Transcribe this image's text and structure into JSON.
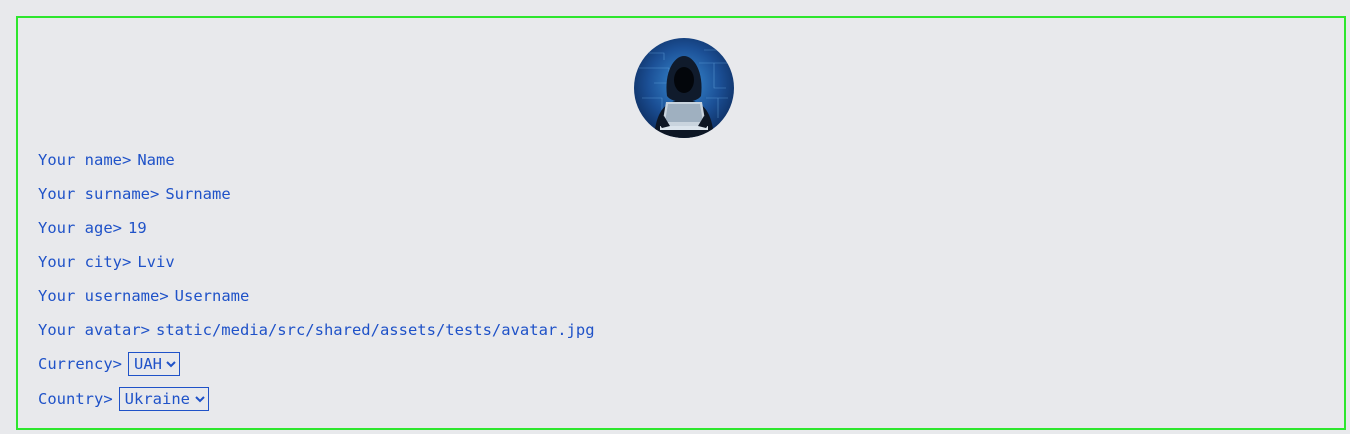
{
  "profile": {
    "name_label": "Your name>",
    "name_value": "Name",
    "surname_label": "Your surname>",
    "surname_value": "Surname",
    "age_label": "Your age>",
    "age_value": "19",
    "city_label": "Your city>",
    "city_value": "Lviv",
    "username_label": "Your username>",
    "username_value": "Username",
    "avatar_label": "Your avatar>",
    "avatar_value": "static/media/src/shared/assets/tests/avatar.jpg",
    "currency_label": "Currency>",
    "currency_selected": "UAH",
    "country_label": "Country>",
    "country_selected": "Ukraine"
  },
  "colors": {
    "text": "#1f52c8",
    "border": "#2ee62e",
    "background": "#e8e9ec"
  },
  "icons": {
    "avatar": "hooded-hacker-avatar-image"
  }
}
